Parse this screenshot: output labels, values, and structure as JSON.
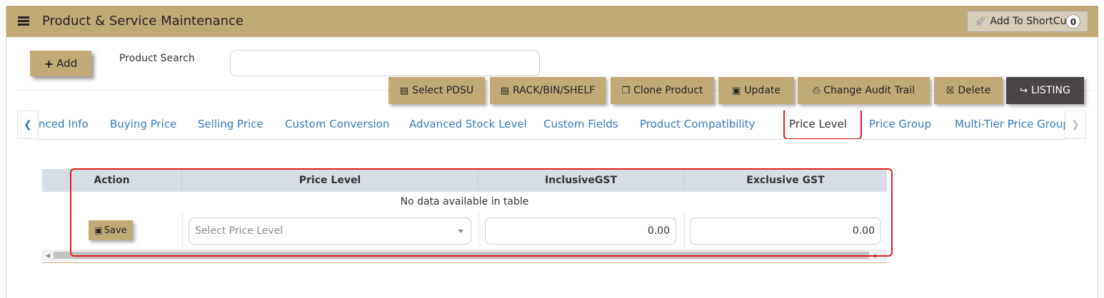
{
  "header": {
    "title": "Product & Service Maintenance",
    "shortcut_label": "Add To ShortCut",
    "shortcut_count": "0"
  },
  "toolbar": {
    "add_label": "Add",
    "search_label": "Product Search",
    "search_value": "",
    "buttons": [
      {
        "label": "Select PDSU",
        "icon": "archive-icon"
      },
      {
        "label": "RACK/BIN/SHELF",
        "icon": "archive-icon"
      },
      {
        "label": "Clone Product",
        "icon": "copy-icon"
      },
      {
        "label": "Update",
        "icon": "floppy-icon"
      },
      {
        "label": "Change Audit Trail",
        "icon": "print-icon"
      },
      {
        "label": "Delete",
        "icon": "trash-icon"
      },
      {
        "label": "LISTING",
        "icon": "sign-out-icon"
      }
    ]
  },
  "tabs": {
    "items": [
      {
        "label": "nced Info"
      },
      {
        "label": "Buying Price"
      },
      {
        "label": "Selling Price"
      },
      {
        "label": "Custom Conversion"
      },
      {
        "label": "Advanced Stock Level"
      },
      {
        "label": "Custom Fields"
      },
      {
        "label": "Product Compatibility"
      },
      {
        "label": "Price Level"
      },
      {
        "label": "Price Group"
      },
      {
        "label": "Multi-Tier Price Group"
      }
    ],
    "active": "Price Level"
  },
  "table": {
    "columns": [
      "Action",
      "Price Level",
      "InclusiveGST",
      "Exclusive GST"
    ],
    "empty_message": "No data available in table",
    "save_label": "Save",
    "price_level_placeholder": "Select Price Level",
    "inclusive_value": "0.00",
    "exclusive_value": "0.00"
  },
  "colors": {
    "accent": "#c2aa77",
    "listing_button": "#4a4444",
    "link": "#3479bc",
    "highlight": "#e02020"
  }
}
